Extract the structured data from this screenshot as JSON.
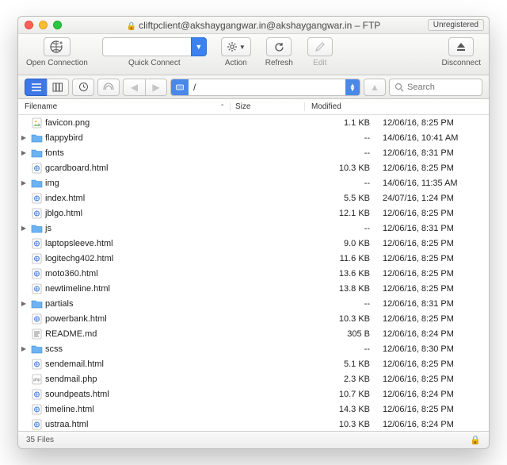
{
  "title": "cliftpclient@akshaygangwar.in@akshaygangwar.in – FTP",
  "unregistered_label": "Unregistered",
  "toolbar": {
    "open_connection": "Open Connection",
    "quick_connect": "Quick Connect",
    "action": "Action",
    "refresh": "Refresh",
    "edit": "Edit",
    "disconnect": "Disconnect"
  },
  "path": "/",
  "search_placeholder": "Search",
  "columns": {
    "filename": "Filename",
    "size": "Size",
    "modified": "Modified"
  },
  "files": [
    {
      "disc": "",
      "type": "png",
      "name": "favicon.png",
      "size": "1.1 KB",
      "modified": "12/06/16, 8:25 PM"
    },
    {
      "disc": "▶",
      "type": "folder",
      "name": "flappybird",
      "size": "--",
      "modified": "14/06/16, 10:41 AM"
    },
    {
      "disc": "▶",
      "type": "folder",
      "name": "fonts",
      "size": "--",
      "modified": "12/06/16, 8:31 PM"
    },
    {
      "disc": "",
      "type": "html",
      "name": "gcardboard.html",
      "size": "10.3 KB",
      "modified": "12/06/16, 8:25 PM"
    },
    {
      "disc": "▶",
      "type": "folder",
      "name": "img",
      "size": "--",
      "modified": "14/06/16, 11:35 AM"
    },
    {
      "disc": "",
      "type": "html",
      "name": "index.html",
      "size": "5.5 KB",
      "modified": "24/07/16, 1:24 PM"
    },
    {
      "disc": "",
      "type": "html",
      "name": "jblgo.html",
      "size": "12.1 KB",
      "modified": "12/06/16, 8:25 PM"
    },
    {
      "disc": "▶",
      "type": "folder",
      "name": "js",
      "size": "--",
      "modified": "12/06/16, 8:31 PM"
    },
    {
      "disc": "",
      "type": "html",
      "name": "laptopsleeve.html",
      "size": "9.0 KB",
      "modified": "12/06/16, 8:25 PM"
    },
    {
      "disc": "",
      "type": "html",
      "name": "logitechg402.html",
      "size": "11.6 KB",
      "modified": "12/06/16, 8:25 PM"
    },
    {
      "disc": "",
      "type": "html",
      "name": "moto360.html",
      "size": "13.6 KB",
      "modified": "12/06/16, 8:25 PM"
    },
    {
      "disc": "",
      "type": "html",
      "name": "newtimeline.html",
      "size": "13.8 KB",
      "modified": "12/06/16, 8:25 PM"
    },
    {
      "disc": "▶",
      "type": "folder",
      "name": "partials",
      "size": "--",
      "modified": "12/06/16, 8:31 PM"
    },
    {
      "disc": "",
      "type": "html",
      "name": "powerbank.html",
      "size": "10.3 KB",
      "modified": "12/06/16, 8:25 PM"
    },
    {
      "disc": "",
      "type": "md",
      "name": "README.md",
      "size": "305 B",
      "modified": "12/06/16, 8:24 PM"
    },
    {
      "disc": "▶",
      "type": "folder",
      "name": "scss",
      "size": "--",
      "modified": "12/06/16, 8:30 PM"
    },
    {
      "disc": "",
      "type": "html",
      "name": "sendemail.html",
      "size": "5.1 KB",
      "modified": "12/06/16, 8:25 PM"
    },
    {
      "disc": "",
      "type": "php",
      "name": "sendmail.php",
      "size": "2.3 KB",
      "modified": "12/06/16, 8:25 PM"
    },
    {
      "disc": "",
      "type": "html",
      "name": "soundpeats.html",
      "size": "10.7 KB",
      "modified": "12/06/16, 8:24 PM"
    },
    {
      "disc": "",
      "type": "html",
      "name": "timeline.html",
      "size": "14.3 KB",
      "modified": "12/06/16, 8:25 PM"
    },
    {
      "disc": "",
      "type": "html",
      "name": "ustraa.html",
      "size": "10.3 KB",
      "modified": "12/06/16, 8:24 PM"
    }
  ],
  "status": "35 Files"
}
